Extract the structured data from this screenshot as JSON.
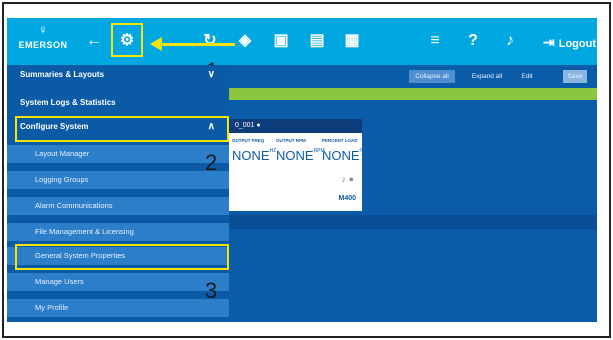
{
  "header": {
    "logo_text": "EMERSON",
    "logout_label": "Logout",
    "icons": [
      "back-arrow-icon",
      "gear-icon",
      "pivot-icon",
      "cube-icon",
      "calendar-icon",
      "map-icon",
      "panel-icon",
      "list-add-icon",
      "help-icon",
      "bell-icon",
      "logout-icon"
    ]
  },
  "annotations": {
    "step1": "1",
    "step2": "2",
    "step3": "3"
  },
  "sidebar": {
    "items": [
      {
        "label": "Summaries & Layouts"
      },
      {
        "label": "System Logs & Statistics"
      },
      {
        "label": "Configure System"
      }
    ],
    "subitems": [
      {
        "label": "Layout Manager"
      },
      {
        "label": "Logging Groups"
      },
      {
        "label": "Alarm Communications"
      },
      {
        "label": "File Management & Licensing"
      },
      {
        "label": "General System Properties"
      },
      {
        "label": "Manage Users"
      },
      {
        "label": "My Profile"
      }
    ]
  },
  "toolbar": {
    "collapse_label": "Collapse all",
    "expand_label": "Expand all",
    "edit_label": "Edit",
    "save_label": "Save"
  },
  "card": {
    "title": "0_001",
    "metrics": [
      {
        "label": "OUTPUT FREQ",
        "value": "NONE",
        "unit": "HZ"
      },
      {
        "label": "OUTPUT RPM",
        "value": "NONE",
        "unit": "RPM"
      },
      {
        "label": "PERCENT LOAD",
        "value": "NONE",
        "unit": "%"
      }
    ],
    "model": "M400"
  },
  "colors": {
    "header": "#00a7e1",
    "sidebar": "#0a5aa6",
    "highlight": "#f5e30a",
    "green": "#8cc63f"
  }
}
